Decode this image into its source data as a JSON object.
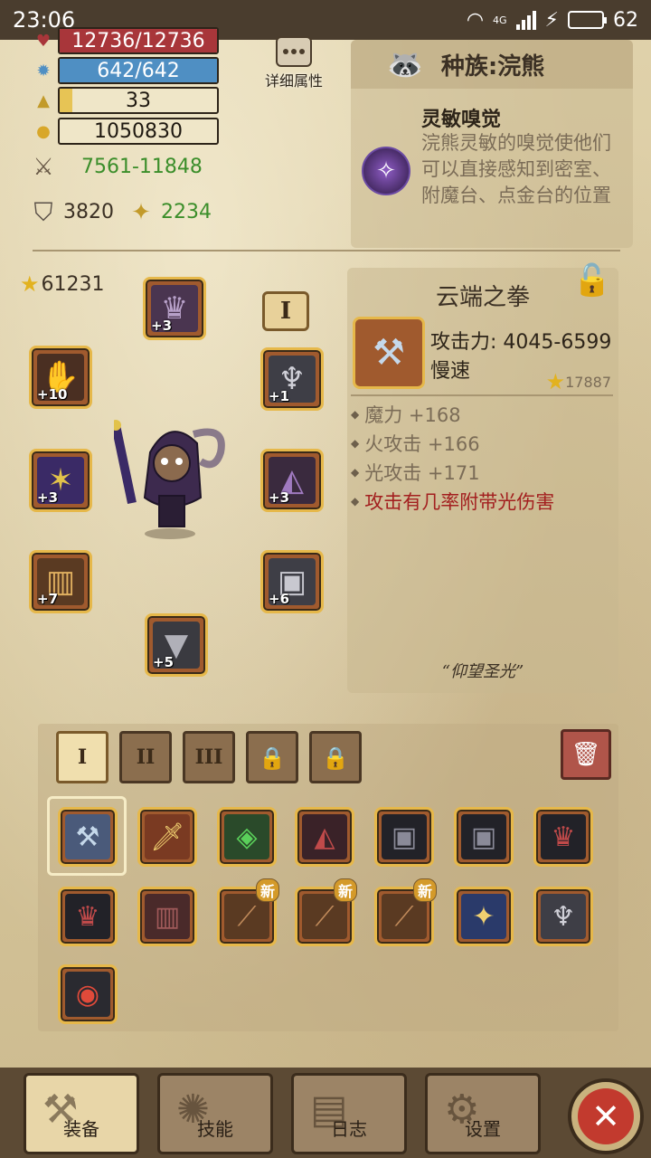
{
  "status_bar": {
    "time": "23:06",
    "network": "4G",
    "battery": "62"
  },
  "stats": {
    "hp": "12736/12736",
    "mp": "642/642",
    "level": "33",
    "level_progress": 0.08,
    "gold": "1050830",
    "attack": "7561-11848",
    "defense": "3820",
    "resist": "2234"
  },
  "detail_button": {
    "label": "详细属性"
  },
  "race": {
    "title": "种族:浣熊",
    "ability_name": "灵敏嗅觉",
    "ability_desc": "浣熊灵敏的嗅觉使他们可以直接感知到密室、附魔台、点金台的位置"
  },
  "equipment": {
    "power": "61231",
    "set_tag": "I",
    "slots": [
      {
        "name": "helmet",
        "plus": "+3"
      },
      {
        "name": "gloves",
        "plus": "+10"
      },
      {
        "name": "amulet",
        "plus": "+1"
      },
      {
        "name": "weapon-rocket",
        "plus": "+3"
      },
      {
        "name": "shoulder",
        "plus": "+3"
      },
      {
        "name": "bracer",
        "plus": "+7"
      },
      {
        "name": "armor",
        "plus": "+6"
      },
      {
        "name": "boots",
        "plus": "+5"
      }
    ]
  },
  "item": {
    "name": "云端之拳",
    "attack": "攻击力: 4045-6599",
    "speed": "慢速",
    "score": "17887",
    "stats": [
      {
        "text": "魔力 +168",
        "highlight": false
      },
      {
        "text": "火攻击 +166",
        "highlight": false
      },
      {
        "text": "光攻击 +171",
        "highlight": false
      },
      {
        "text": "攻击有几率附带光伤害",
        "highlight": true
      }
    ],
    "quote": "“仰望圣光”"
  },
  "inventory": {
    "tabs": [
      "I",
      "II",
      "III"
    ],
    "new_label": "新"
  },
  "nav": {
    "equip": "装备",
    "skills": "技能",
    "log": "日志",
    "settings": "设置"
  },
  "colors": {
    "accent": "#e6b84a",
    "hp": "#a8363a",
    "mp": "#4f8fc3",
    "danger": "#c23a2e"
  }
}
